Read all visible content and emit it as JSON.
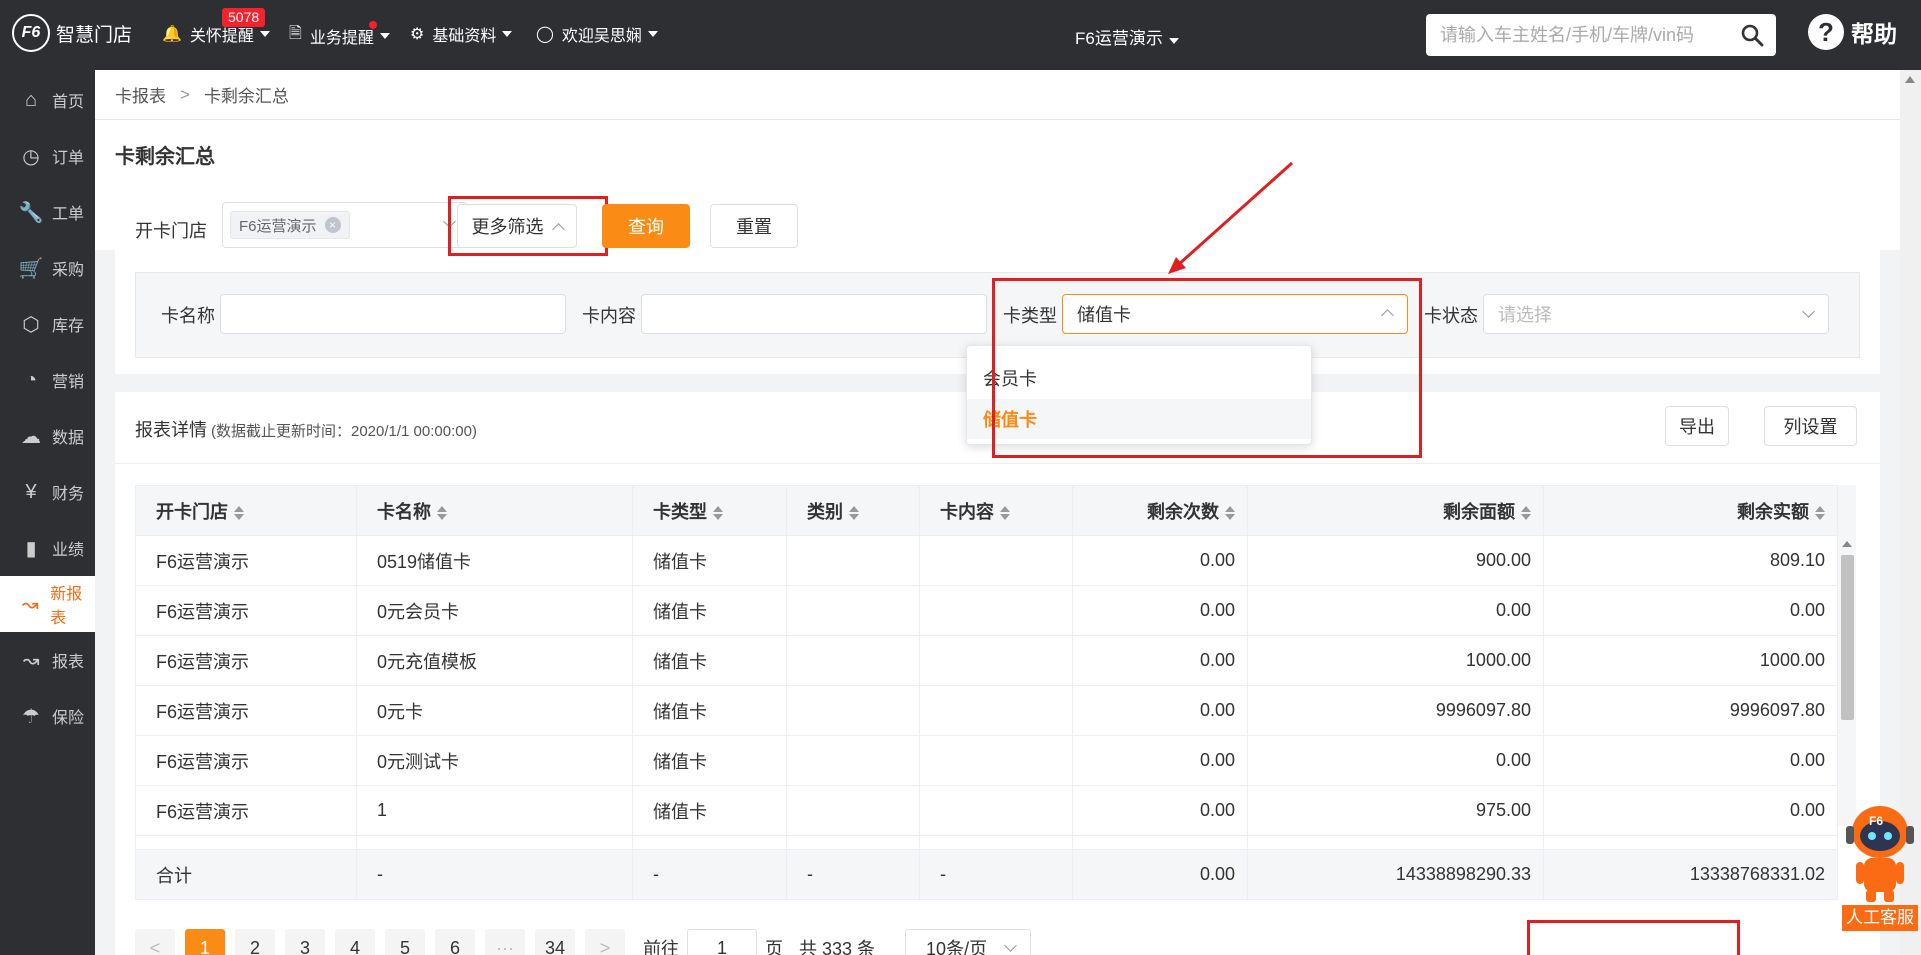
{
  "topbar": {
    "logo_mark": "F6",
    "app_name": "智慧门店",
    "nav": [
      {
        "label": "关怀提醒",
        "icon": "bell-icon"
      },
      {
        "label": "业务提醒",
        "icon": "document-icon"
      },
      {
        "label": "基础资料",
        "icon": "gear-icon"
      },
      {
        "label": "欢迎吴思娴",
        "icon": "user-icon"
      }
    ],
    "care_badge": "5078",
    "store": "F6运营演示",
    "search_placeholder": "请输入车主姓名/手机/车牌/vin码",
    "help": "帮助"
  },
  "sidebar": {
    "items": [
      {
        "label": "首页",
        "icon": "home-icon"
      },
      {
        "label": "订单",
        "icon": "clock-icon"
      },
      {
        "label": "工单",
        "icon": "wrench-icon"
      },
      {
        "label": "采购",
        "icon": "cart-icon"
      },
      {
        "label": "库存",
        "icon": "cube-icon"
      },
      {
        "label": "营销",
        "icon": "pie-icon"
      },
      {
        "label": "数据",
        "icon": "cloud-icon"
      },
      {
        "label": "财务",
        "icon": "yen-icon"
      },
      {
        "label": "业绩",
        "icon": "bar-chart-icon"
      },
      {
        "label": "新报表",
        "icon": "line-chart-icon"
      },
      {
        "label": "报表",
        "icon": "line-chart-icon"
      },
      {
        "label": "保险",
        "icon": "umbrella-icon"
      }
    ],
    "active_index": 9
  },
  "breadcrumb": {
    "parent": "卡报表",
    "sep": ">",
    "current": "卡剩余汇总"
  },
  "page_title": "卡剩余汇总",
  "filters": {
    "store_label": "开卡门店",
    "store_tag": "F6运营演示",
    "more_filter": "更多筛选",
    "query": "查询",
    "reset": "重置",
    "card_name_label": "卡名称",
    "card_name_value": "",
    "card_content_label": "卡内容",
    "card_content_value": "",
    "card_type_label": "卡类型",
    "card_type_value": "储值卡",
    "card_status_label": "卡状态",
    "card_status_placeholder": "请选择",
    "card_type_options": [
      "会员卡",
      "储值卡"
    ],
    "card_type_selected": "储值卡"
  },
  "report": {
    "title": "报表详情",
    "subtitle": "(数据截止更新时间：2020/1/1 00:00:00)",
    "export": "导出",
    "columns_setting": "列设置",
    "columns": [
      "开卡门店",
      "卡名称",
      "卡类型",
      "类别",
      "卡内容",
      "剩余次数",
      "剩余面额",
      "剩余实额"
    ],
    "rows": [
      [
        "F6运营演示",
        "0519储值卡",
        "储值卡",
        "",
        "",
        "0.00",
        "900.00",
        "809.10"
      ],
      [
        "F6运营演示",
        "0元会员卡",
        "储值卡",
        "",
        "",
        "0.00",
        "0.00",
        "0.00"
      ],
      [
        "F6运营演示",
        "0元充值模板",
        "储值卡",
        "",
        "",
        "0.00",
        "1000.00",
        "1000.00"
      ],
      [
        "F6运营演示",
        "0元卡",
        "储值卡",
        "",
        "",
        "0.00",
        "9996097.80",
        "9996097.80"
      ],
      [
        "F6运营演示",
        "0元测试卡",
        "储值卡",
        "",
        "",
        "0.00",
        "0.00",
        "0.00"
      ],
      [
        "F6运营演示",
        "1",
        "储值卡",
        "",
        "",
        "0.00",
        "975.00",
        "0.00"
      ]
    ],
    "total": [
      "合计",
      "-",
      "-",
      "-",
      "-",
      "0.00",
      "14338898290.33",
      "13338768331.02"
    ]
  },
  "pagination": {
    "prev": "<",
    "pages": [
      "1",
      "2",
      "3",
      "4",
      "5",
      "6"
    ],
    "ellipsis": "···",
    "last": "34",
    "next": ">",
    "current": "1",
    "goto_label": "前往",
    "goto_value": "1",
    "page_unit": "页",
    "total_text": "共 333 条",
    "page_size": "10条/页"
  },
  "chat_widget": {
    "label": "人工客服",
    "badge": "F6"
  },
  "colors": {
    "accent": "#fa8c16",
    "annotation": "#e02020",
    "topbar": "#2d2f33"
  }
}
